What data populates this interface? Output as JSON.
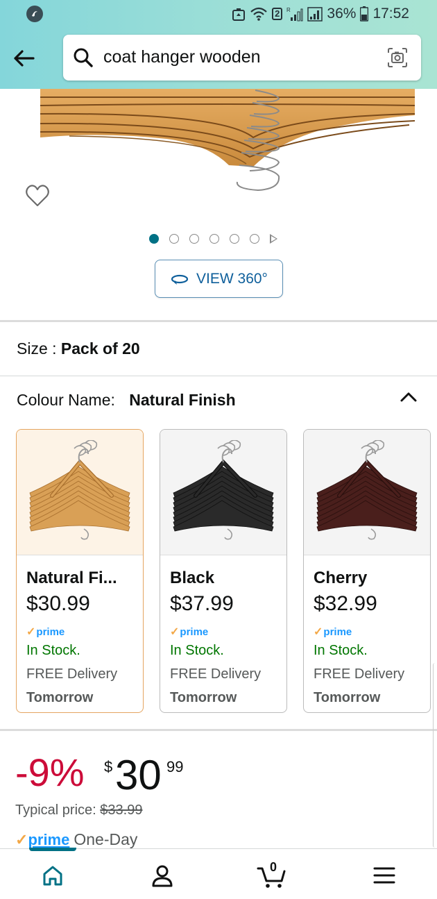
{
  "status_bar": {
    "wifi_badge": "2",
    "battery": "36%",
    "time": "17:52"
  },
  "search": {
    "query": "coat hanger wooden"
  },
  "carousel": {
    "total_dots": 6,
    "active_index": 0
  },
  "view360": {
    "label": "VIEW 360°"
  },
  "size": {
    "label": "Size : ",
    "value": "Pack of 20"
  },
  "colour": {
    "label": "Colour Name:",
    "value": "Natural Finish"
  },
  "colour_options": [
    {
      "name": "Natural Fi...",
      "price": "$30.99",
      "prime": "prime",
      "stock": "In Stock.",
      "delivery": "FREE Delivery",
      "day": "Tomorrow",
      "selected": true,
      "hanger_color": "#d9a056",
      "hanger_edge": "#a86f2e"
    },
    {
      "name": "Black",
      "price": "$37.99",
      "prime": "prime",
      "stock": "In Stock.",
      "delivery": "FREE Delivery",
      "day": "Tomorrow",
      "selected": false,
      "hanger_color": "#2a2a2a",
      "hanger_edge": "#111111"
    },
    {
      "name": "Cherry",
      "price": "$32.99",
      "prime": "prime",
      "stock": "In Stock.",
      "delivery": "FREE Delivery",
      "day": "Tomorrow",
      "selected": false,
      "hanger_color": "#4a1f1c",
      "hanger_edge": "#2a100e"
    }
  ],
  "pricing": {
    "discount": "-9%",
    "currency": "$",
    "whole": "30",
    "fraction": "99",
    "typical_label": "Typical price: ",
    "typical_value": "$33.99",
    "prime_label": "prime",
    "delivery_speed": "One-Day"
  },
  "bottom_nav": {
    "active": "home",
    "cart_count": "0"
  },
  "colors": {
    "accent": "#007185",
    "discount_red": "#cc0c39",
    "in_stock_green": "#007600",
    "prime_blue": "#1a98ff"
  }
}
